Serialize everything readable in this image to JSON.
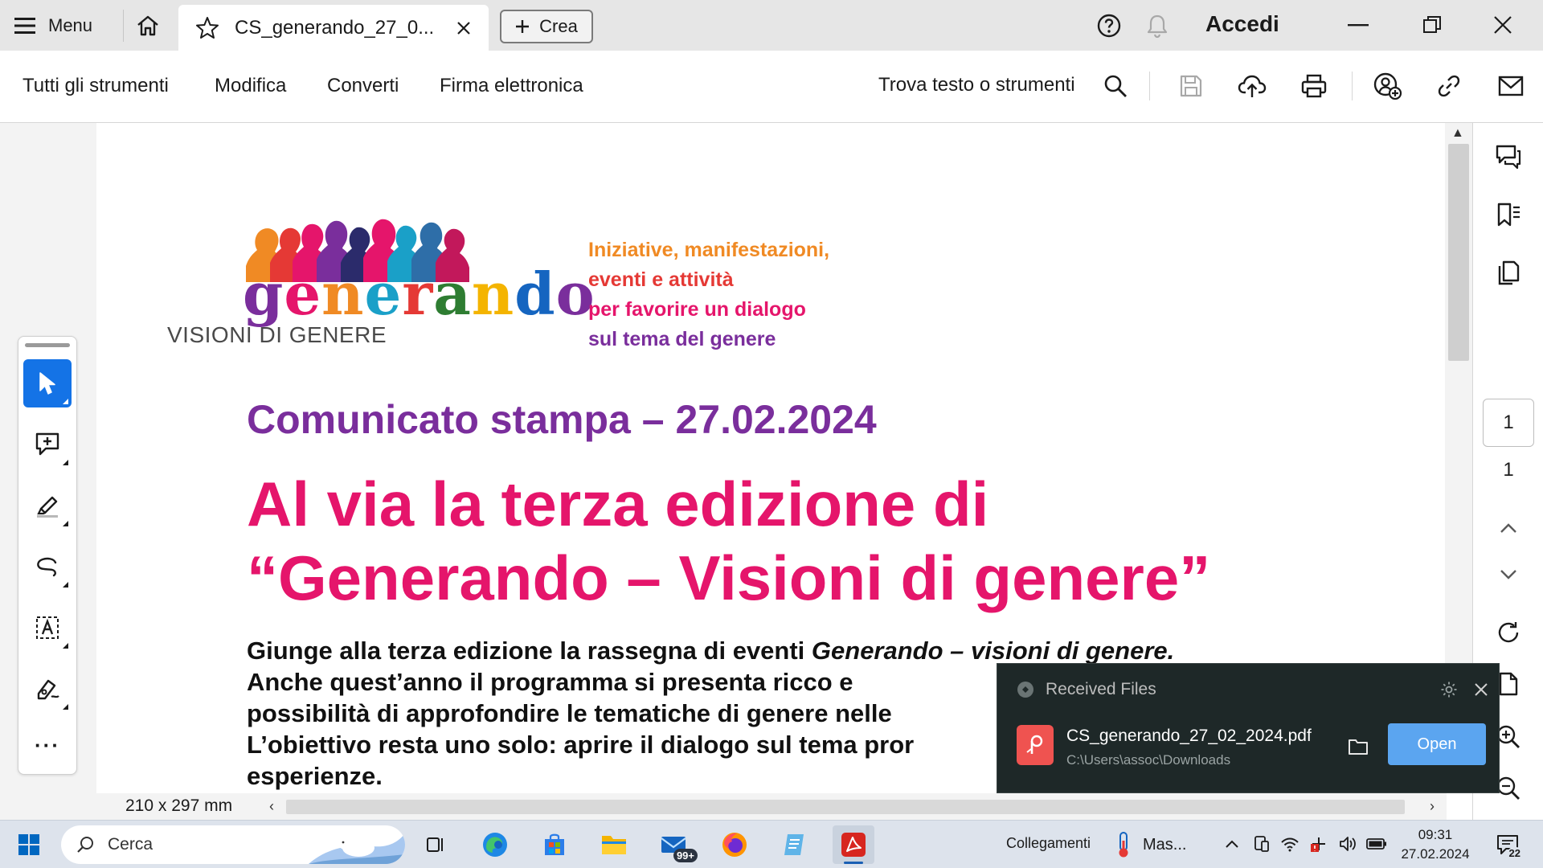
{
  "titlebar": {
    "menu_label": "Menu",
    "tab_title": "CS_generando_27_0...",
    "crea_label": "Crea",
    "accedi_label": "Accedi"
  },
  "toolbar": {
    "menus": [
      "Tutti gli strumenti",
      "Modifica",
      "Converti",
      "Firma elettronica"
    ],
    "find_label": "Trova testo o strumenti"
  },
  "document": {
    "logo_word": [
      "g",
      "e",
      "n",
      "e",
      "r",
      "a",
      "n",
      "d",
      "o"
    ],
    "logo_colors": [
      "#7a2e9c",
      "#e5156b",
      "#f08a24",
      "#1aa0c8",
      "#e53935",
      "#2e7d32",
      "#f4b400",
      "#1565c0",
      "#7a2e9c"
    ],
    "logo_sub": "VISIONI DI GENERE",
    "tagline": [
      {
        "text": "Iniziative, manifestazioni,",
        "color": "#f08a24"
      },
      {
        "text": "eventi e attività",
        "color": "#e53935"
      },
      {
        "text": "per favorire un dialogo",
        "color": "#e5156b"
      },
      {
        "text": "sul tema del genere",
        "color": "#7a2e9c"
      }
    ],
    "press_title": "Comunicato stampa – 27.02.2024",
    "headline": [
      "Al via la terza edizione di",
      "“Generando – Visioni di genere”"
    ],
    "body": {
      "line1_pre": "Giunge alla terza edizione la rassegna di eventi ",
      "line1_italic": "Generando – visioni di genere.",
      "line2": "Anche quest’anno il programma si presenta ricco e",
      "line3": "possibilità di approfondire le tematiche di genere nelle",
      "line4": "L’obiettivo resta uno solo: aprire il dialogo sul tema pror",
      "line5": "esperienze."
    },
    "page_size": "210 x 297 mm"
  },
  "right_panel": {
    "current_page": "1",
    "total_pages": "1"
  },
  "toast": {
    "title": "Received Files",
    "filename": "CS_generando_27_02_2024.pdf",
    "path": "C:\\Users\\assoc\\Downloads",
    "open_label": "Open"
  },
  "taskbar": {
    "search_placeholder": "Cerca",
    "mail_badge": "99+",
    "collegamenti": "Collegamenti",
    "weather_label": "Mas...",
    "time": "09:31",
    "date": "27.02.2024",
    "notification_count": "22"
  },
  "colors": {
    "accent_blue": "#1473e6",
    "press_purple": "#7a2e9c",
    "headline_pink": "#e5156b",
    "toast_bg": "#1e2828",
    "open_button": "#5ba5f0"
  }
}
